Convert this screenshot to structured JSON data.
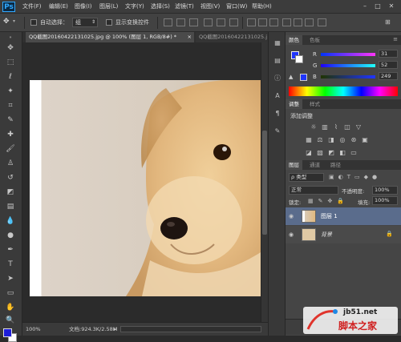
{
  "app": {
    "logo": "Ps"
  },
  "menu": [
    "文件(F)",
    "编辑(E)",
    "图像(I)",
    "图层(L)",
    "文字(Y)",
    "选择(S)",
    "滤镜(T)",
    "视图(V)",
    "窗口(W)",
    "帮助(H)"
  ],
  "window_buttons": {
    "minimize": "–",
    "maximize": "□",
    "close": "✕"
  },
  "options": {
    "auto_select_label": "自动选择：",
    "auto_select_value": "组",
    "show_transform_label": "显示变换控件"
  },
  "tabs": {
    "active": "QQ截图20160422131025.jpg @ 100% (图层 1, RGB/8#) *",
    "active_close": "×",
    "inactive": "QQ截图20160422131025.j"
  },
  "status": {
    "zoom": "100%",
    "doc": "文档:924.3K/2.58M",
    "arrow": "▸"
  },
  "color_panel": {
    "tabs": [
      "颜色",
      "色板"
    ],
    "r_label": "R",
    "r_value": "31",
    "g_label": "G",
    "g_value": "52",
    "b_label": "B",
    "b_value": "249",
    "fg_color": "#1f34f9"
  },
  "adjust_panel": {
    "tabs": [
      "调整",
      "样式"
    ],
    "title": "添加调整"
  },
  "layers_panel": {
    "tabs": [
      "图层",
      "通道",
      "路径"
    ],
    "kind_label": "ρ 类型",
    "blend_mode": "正常",
    "opacity_label": "不透明度:",
    "opacity_value": "100%",
    "lock_label": "锁定:",
    "fill_label": "填充:",
    "fill_value": "100%",
    "layers": [
      {
        "name": "图层 1",
        "selected": true
      },
      {
        "name": "背景",
        "selected": false
      }
    ]
  },
  "watermark": {
    "site": "jb51.net",
    "title": "脚本之家"
  }
}
